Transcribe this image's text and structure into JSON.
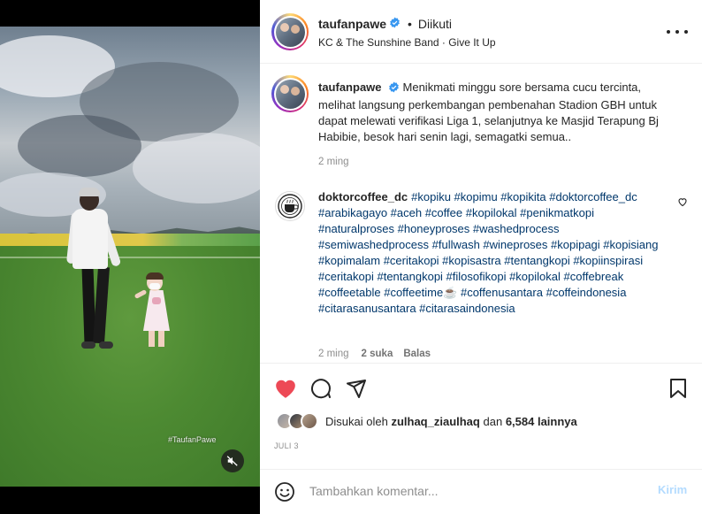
{
  "media": {
    "watermark": "#TaufanPawe",
    "mute_icon": "speaker-muted-icon"
  },
  "header": {
    "username": "taufanpawe",
    "separator": "•",
    "follow_status": "Diikuti",
    "music": "KC & The Sunshine Band · Give It Up"
  },
  "caption": {
    "username": "taufanpawe",
    "text": "Menikmati minggu sore bersama cucu tercinta, melihat langsung perkembangan pembenahan Stadion GBH untuk dapat melewati verifikasi Liga 1, selanjutnya ke Masjid Terapung Bj Habibie, besok hari senin lagi, semagatki semua..",
    "time": "2 ming"
  },
  "comment1": {
    "username": "doktorcoffee_dc",
    "text": "#kopiku #kopimu #kopikita #doktorcoffee_dc #arabikagayo #aceh #coffee #kopilokal #penikmatkopi #naturalproses #honeyproses #washedprocess #semiwashedprocess #fullwash #wineproses #kopipagi #kopisiang #kopimalam #ceritakopi #kopisastra #tentangkopi #kopiinspirasi #ceritakopi #tentangkopi #filosofikopi #kopilokal #coffebreak #coffeetable #coffeetime☕ #coffenusantara #coffeindonesia #citarasanusantara #citarasaindonesia",
    "time": "2 ming",
    "likes": "2 suka",
    "reply": "Balas"
  },
  "likes": {
    "prefix": "Disukai oleh",
    "user": "zulhaq_ziaulhaq",
    "conj": "dan",
    "others": "6,584 lainnya"
  },
  "post_date": "JULI 3",
  "composer": {
    "placeholder": "Tambahkan komentar...",
    "send_label": "Kirim"
  },
  "colors": {
    "liked_heart": "#ed4956",
    "verified": "#3897f0",
    "send_disabled": "#b3dbff"
  }
}
